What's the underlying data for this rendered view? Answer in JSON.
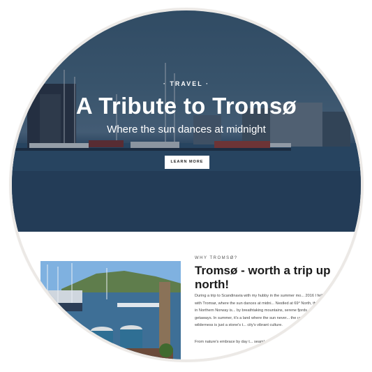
{
  "hero": {
    "kicker": "· TRAVEL ·",
    "title": "A Tribute to Tromsø",
    "subtitle": "Where the sun dances at midnight",
    "cta_label": "LEARN MORE"
  },
  "section": {
    "eyebrow": "WHY TROMSØ?",
    "heading": "Tromsø - worth a trip up north!",
    "paragraph_1": "During a trip to Scandinavia with my hubby in the summer mo... 2016 I fell in love with Tromsø, where the sun dances at midni... Nestled at 69° North, this Arctic gem in Northern Norway is... by breathtaking mountains, serene fjords, and delight... getaways. In summer, it's a land where the sun never... the unspoiled Arctic wilderness is just a stone's t... city's vibrant culture.",
    "paragraph_2": "From nature's embrace by day t... seamlessly woven togethe... experiences..."
  },
  "colors": {
    "accent_dark": "#1a1a1a",
    "hero_overlay": "#19283c",
    "water": "#2a4a68"
  }
}
